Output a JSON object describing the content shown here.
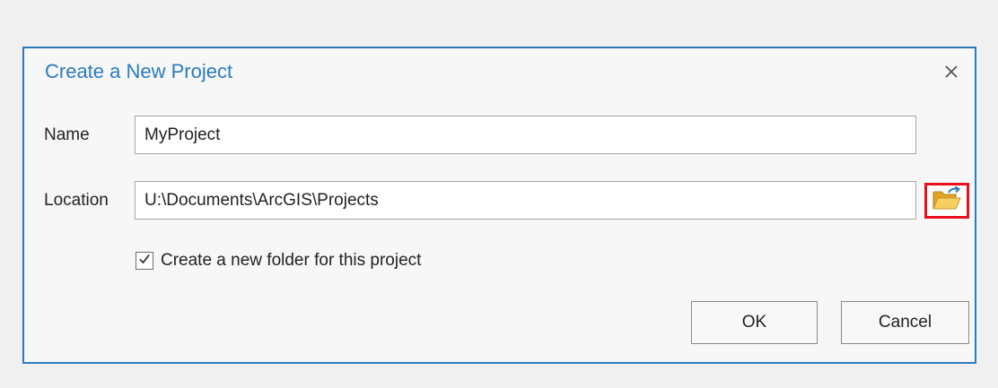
{
  "dialog": {
    "title": "Create a New Project",
    "close_icon": "close-icon"
  },
  "fields": {
    "name": {
      "label": "Name",
      "value": "MyProject"
    },
    "location": {
      "label": "Location",
      "value": "U:\\Documents\\ArcGIS\\Projects",
      "browse_icon": "folder-open-icon"
    }
  },
  "options": {
    "create_folder": {
      "label": "Create a new folder for this project",
      "checked": true
    }
  },
  "buttons": {
    "ok": "OK",
    "cancel": "Cancel"
  },
  "colors": {
    "accent": "#2b7bc0",
    "highlight_border": "#e8101c",
    "folder": "#f2c14e"
  }
}
